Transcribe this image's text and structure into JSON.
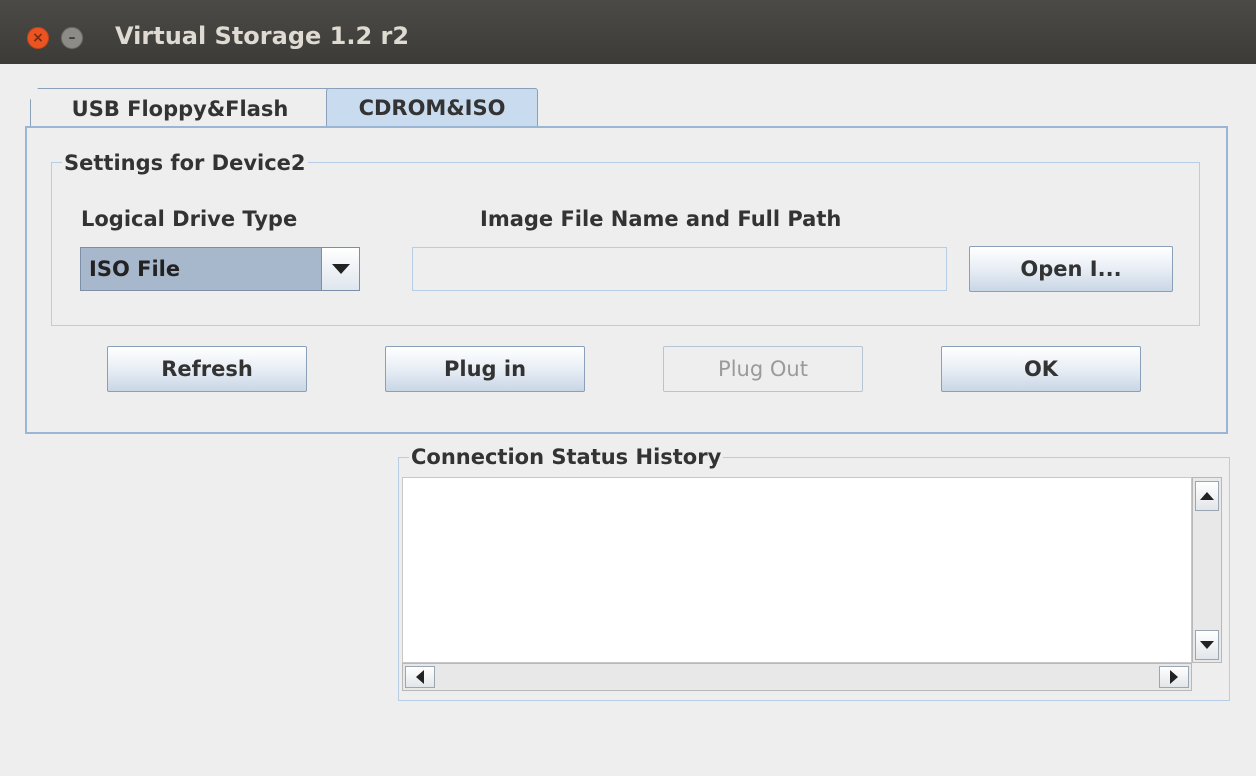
{
  "window": {
    "title": "Virtual Storage 1.2 r2",
    "close_glyph": "×",
    "minimize_glyph": "–"
  },
  "tabs": [
    {
      "label": "USB Floppy&Flash",
      "selected": false
    },
    {
      "label": "CDROM&ISO",
      "selected": true
    }
  ],
  "settings": {
    "group_title": "Settings for Device2",
    "drive_type_label": "Logical Drive Type",
    "drive_type_value": "ISO File",
    "image_path_label": "Image File Name and Full Path",
    "image_path_value": "",
    "open_button": "Open I..."
  },
  "actions": {
    "refresh": "Refresh",
    "plug_in": "Plug in",
    "plug_out": "Plug Out",
    "ok": "OK"
  },
  "status": {
    "group_title": "Connection Status History",
    "history_text": ""
  },
  "colors": {
    "accent": "#9ab6d4",
    "selected_tab": "#c8dbef",
    "titlebar": "#3c3b37",
    "close_button": "#e95420"
  }
}
